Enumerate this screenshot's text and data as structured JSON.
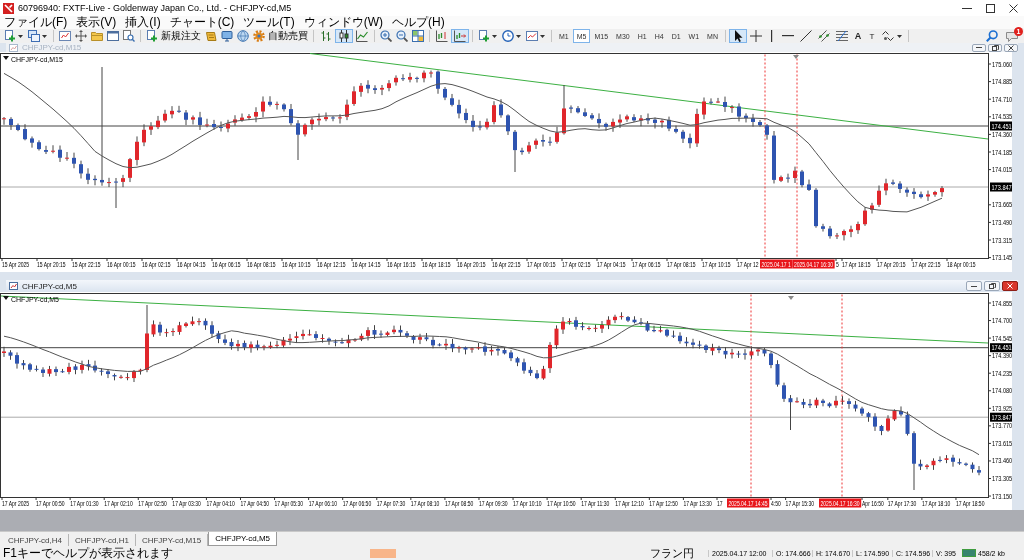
{
  "window": {
    "title": "60796940: FXTF-Live - Goldenway Japan Co., Ltd. - CHFJPY-cd,M5"
  },
  "menu": [
    "ファイル(F)",
    "表示(V)",
    "挿入(I)",
    "チャート(C)",
    "ツール(T)",
    "ウィンドウ(W)",
    "ヘルプ(H)"
  ],
  "toolbar": {
    "new_order": "新規注文",
    "auto_trading": "自動売買",
    "chart_types": [
      {
        "kind": "bar",
        "selected": false
      },
      {
        "kind": "candle",
        "selected": true
      },
      {
        "kind": "line",
        "selected": false
      }
    ],
    "view_toggles": [
      {
        "kind": "chart_shift",
        "on": false
      },
      {
        "kind": "auto_scroll",
        "on": true
      }
    ],
    "timeframes": [
      {
        "label": "M1",
        "selected": false
      },
      {
        "label": "M5",
        "selected": true
      },
      {
        "label": "M15",
        "selected": false
      },
      {
        "label": "M30",
        "selected": false
      },
      {
        "label": "H1",
        "selected": false
      },
      {
        "label": "H4",
        "selected": false
      },
      {
        "label": "D1",
        "selected": false
      },
      {
        "label": "W1",
        "selected": false
      },
      {
        "label": "MN",
        "selected": false
      }
    ],
    "drawing_tools": [
      {
        "kind": "cursor",
        "selected": true
      },
      {
        "kind": "crosshair",
        "selected": false
      },
      {
        "kind": "vertical_line",
        "selected": false
      },
      {
        "kind": "horizontal_line",
        "selected": false
      },
      {
        "kind": "trendline",
        "selected": false
      },
      {
        "kind": "channel",
        "selected": false
      },
      {
        "kind": "fibonacci",
        "selected": false
      },
      {
        "kind": "text",
        "label": "A",
        "selected": false
      },
      {
        "kind": "label",
        "label": "T",
        "selected": false
      },
      {
        "kind": "shapes",
        "selected": false
      }
    ],
    "notification_count": "1"
  },
  "charts": [
    {
      "title": "CHFJPY-cd,M15",
      "active": false,
      "symbol_label": "CHFJPY-cd,M15",
      "price_ticks": [
        "175.060",
        "174.885",
        "174.710",
        "174.535",
        "174.360",
        "174.185",
        "174.015",
        "173.665",
        "173.490",
        "173.315",
        "173.145"
      ],
      "price_lines": [
        "174.451",
        "173.847"
      ],
      "time_labels": [
        "15 Apr 2025",
        "15 Apr 20:15",
        "15 Apr 22:15",
        "16 Apr 00:15",
        "16 Apr 02:15",
        "16 Apr 04:15",
        "16 Apr 06:15",
        "16 Apr 08:15",
        "16 Apr 10:15",
        "16 Apr 12:15",
        "16 Apr 14:15",
        "16 Apr 16:15",
        "16 Apr 18:15",
        "16 Apr 20:15",
        "16 Apr 22:15",
        "17 Apr 00:15",
        "17 Apr 02:15",
        "17 Apr 04:15",
        "17 Apr 06:15",
        "17 Apr 08:15",
        "17 Apr 10:15",
        "17 Apr 12",
        "5",
        "17 Apr 18:15",
        "17 Apr 20:15",
        "17 Apr 22:15",
        "18 Apr 00:15"
      ],
      "time_markers": [
        "2025.04.17 1",
        "2025.04.17 16:30"
      ]
    },
    {
      "title": "CHFJPY-cd,M5",
      "active": true,
      "symbol_label": "CHFJPY-cd,M5",
      "price_ticks": [
        "174.855",
        "174.700",
        "174.545",
        "174.390",
        "174.235",
        "174.080",
        "173.925",
        "173.770",
        "173.615",
        "173.460",
        "173.305",
        "173.150"
      ],
      "price_lines": [
        "174.451",
        "173.847"
      ],
      "time_labels": [
        "17 Apr 2025",
        "17 Apr 00:50",
        "17 Apr 01:30",
        "17 Apr 02:10",
        "17 Apr 02:50",
        "17 Apr 03:30",
        "17 Apr 04:10",
        "17 Apr 04:50",
        "17 Apr 05:30",
        "17 Apr 06:10",
        "17 Apr 06:50",
        "17 Apr 07:30",
        "17 Apr 08:10",
        "17 Apr 08:50",
        "17 Apr 09:30",
        "17 Apr 10:10",
        "17 Apr 10:50",
        "17 Apr 11:30",
        "17 Apr 12:10",
        "17 Apr 12:50",
        "17 Apr 13:30",
        "17",
        "4:50",
        "17 Apr 15:30",
        "Apr 16:50",
        "17 Apr 17:30",
        "17 Apr 18:10",
        "17 Apr 18:50"
      ],
      "time_markers": [
        "2025.04.17 14:45",
        "2025.04.17 16:30"
      ]
    }
  ],
  "tabs": [
    {
      "label": "CHFJPY-cd,H4",
      "selected": false
    },
    {
      "label": "CHFJPY-cd,H1",
      "selected": false
    },
    {
      "label": "CHFJPY-cd,M15",
      "selected": false
    },
    {
      "label": "CHFJPY-cd,M5",
      "selected": true
    }
  ],
  "status_bar": {
    "help": "F1キーでヘルプが表示されます",
    "symbol": "フラン円",
    "time": "2025.04.17 12:00",
    "open": "O: 174.666",
    "high": "H: 174.670",
    "low": "L: 174.590",
    "close": "C: 174.596",
    "volume": "V: 395",
    "traffic": "458/2 kb"
  }
}
